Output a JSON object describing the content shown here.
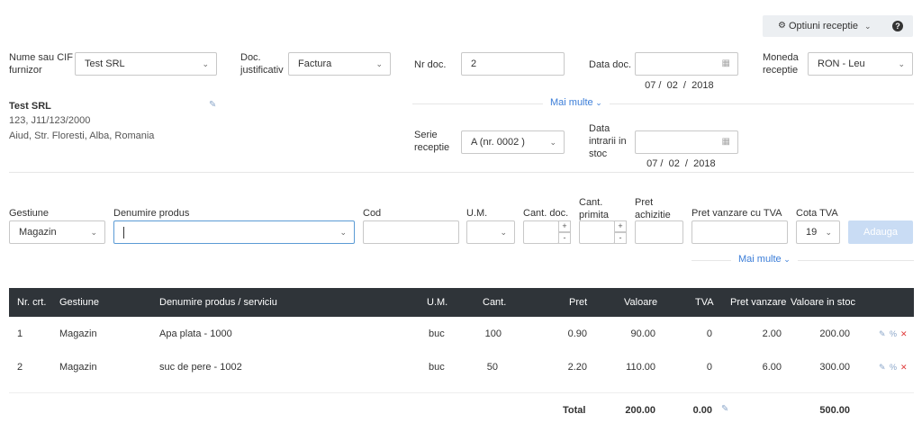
{
  "toolbar": {
    "options_label": "Optiuni receptie",
    "help_icon": "?"
  },
  "supplier": {
    "label_line1": "Nume sau CIF",
    "label_line2": "furnizor",
    "value": "Test SRL"
  },
  "doc_type": {
    "label_line1": "Doc.",
    "label_line2": "justificativ",
    "value": "Factura"
  },
  "doc_nr": {
    "label": "Nr doc.",
    "value": "2"
  },
  "doc_date": {
    "label": "Data doc.",
    "value": "07 /  02  /  2018"
  },
  "currency": {
    "label_line1": "Moneda",
    "label_line2": "receptie",
    "value": "RON - Leu"
  },
  "company": {
    "name": "Test SRL",
    "reg": "123, J11/123/2000",
    "address": "Aiud, Str. Floresti, Alba, Romania"
  },
  "more_link_top": "Mai multe",
  "series": {
    "label_line1": "Serie",
    "label_line2": "receptie",
    "value": "A (nr. 0002 )"
  },
  "entry_date": {
    "label_line1": "Data",
    "label_line2": "intrarii in",
    "label_line3": "stoc",
    "value": "07 /  02  /  2018"
  },
  "product_form": {
    "gestiune_label": "Gestiune",
    "gestiune_value": "Magazin",
    "product_label": "Denumire produs",
    "product_value": "",
    "cod_label": "Cod",
    "um_label": "U.M.",
    "cant_doc_label": "Cant. doc.",
    "cant_primita_label_1": "Cant.",
    "cant_primita_label_2": "primita",
    "pret_achizitie_label_1": "Pret",
    "pret_achizitie_label_2": "achizitie",
    "pret_vanzare_label": "Pret vanzare cu TVA",
    "cota_tva_label": "Cota TVA",
    "cota_tva_value": "19",
    "add_button": "Adauga",
    "more_link": "Mai multe"
  },
  "table": {
    "headers": {
      "nr": "Nr. crt.",
      "gestiune": "Gestiune",
      "denumire": "Denumire produs / serviciu",
      "um": "U.M.",
      "cant": "Cant.",
      "pret": "Pret",
      "valoare": "Valoare",
      "tva": "TVA",
      "pret_vanzare": "Pret vanzare",
      "valoare_stoc": "Valoare in stoc"
    },
    "rows": [
      {
        "nr": "1",
        "gestiune": "Magazin",
        "denumire": "Apa plata - 1000",
        "um": "buc",
        "cant": "100",
        "pret": "0.90",
        "valoare": "90.00",
        "tva": "0",
        "pret_vanzare": "2.00",
        "valoare_stoc": "200.00"
      },
      {
        "nr": "2",
        "gestiune": "Magazin",
        "denumire": "suc de pere - 1002",
        "um": "buc",
        "cant": "50",
        "pret": "2.20",
        "valoare": "110.00",
        "tva": "0",
        "pret_vanzare": "6.00",
        "valoare_stoc": "300.00"
      }
    ],
    "totals": {
      "label": "Total",
      "valoare": "200.00",
      "tva": "0.00",
      "valoare_stoc": "500.00"
    }
  },
  "colors": {
    "header_bg": "#2f3439",
    "link": "#3b7dd8",
    "add_button_bg": "#c9dcf4",
    "delete": "#e03a3a"
  }
}
